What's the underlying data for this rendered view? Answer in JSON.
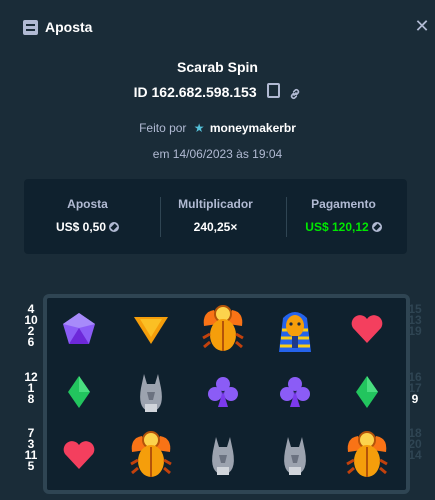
{
  "header": {
    "title": "Aposta",
    "icon": "bet-slip-icon",
    "close_icon": "close-icon"
  },
  "bet": {
    "game": "Scarab Spin",
    "id": "ID 162.682.598.153",
    "played_by_prefix": "Feito por",
    "user": "moneymakerbr",
    "date": "em 14/06/2023 às 19:04"
  },
  "stats": {
    "bet_label": "Aposta",
    "bet_value": "US$ 0,50",
    "multiplier_label": "Multiplicador",
    "multiplier_value": "240,25×",
    "payout_label": "Pagamento",
    "payout_value": "US$ 120,12",
    "payout_color": "#00e701"
  },
  "reels": {
    "rows": [
      [
        "purple-gem",
        "yellow-triangle",
        "golden-scarab",
        "pharaoh",
        "red-heart"
      ],
      [
        "green-diamond",
        "grey-cat",
        "purple-club",
        "purple-club",
        "green-diamond"
      ],
      [
        "red-heart",
        "golden-scarab",
        "grey-cat",
        "grey-cat",
        "golden-scarab"
      ]
    ]
  },
  "paylines": {
    "left": [
      [
        "4",
        "10",
        "2",
        "6"
      ],
      [
        "12",
        "1",
        "8"
      ],
      [
        "7",
        "3",
        "11",
        "5"
      ]
    ],
    "right": [
      [
        "15",
        "13",
        "19"
      ],
      [
        "16",
        "17",
        "9"
      ],
      [
        "18",
        "20",
        "14"
      ]
    ],
    "winning": [
      "9"
    ]
  }
}
